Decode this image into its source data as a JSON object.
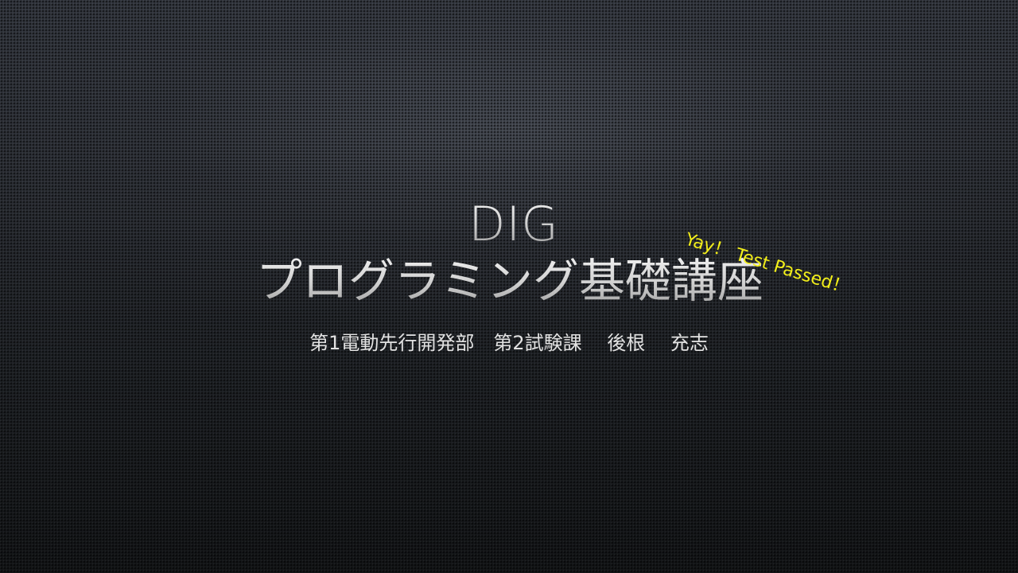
{
  "slide": {
    "title_line1": "DIG",
    "title_line2": "プログラミング基礎講座",
    "subtitle": "第1電動先行開発部　第2試験課　 後根　 充志",
    "stamp_text": "Yay！ Test Passed！",
    "colors": {
      "background": "#23262b",
      "title": "#d8d8d8",
      "subtitle": "#e2e2e2",
      "stamp": "#f2ee1a"
    }
  }
}
